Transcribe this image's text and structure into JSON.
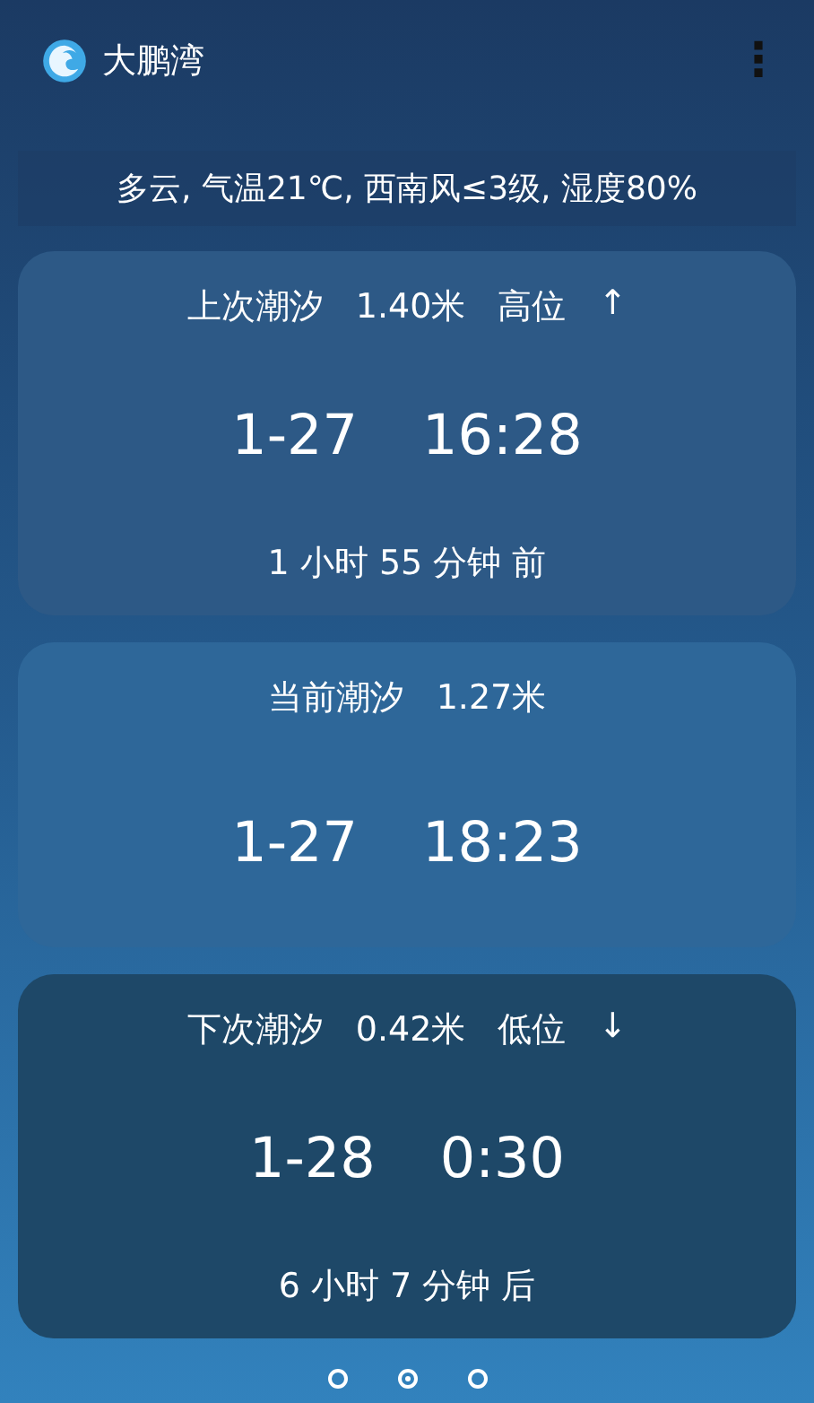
{
  "app_bar": {
    "title": "大鹏湾",
    "menu": "⋮"
  },
  "weather": "多云, 气温21℃, 西南风≤3级, 湿度80%",
  "tides": [
    {
      "label": "上次潮汐",
      "height": "1.40米",
      "type": "高位",
      "arrow": "↑",
      "date": "1-27",
      "time": "16:28",
      "relative": "1 小时 55 分钟 前",
      "color": "#2d5986"
    },
    {
      "label": "当前潮汐",
      "height": "1.27米",
      "date": "1-27",
      "time": "18:23",
      "color": "#2e6799"
    },
    {
      "label": "下次潮汐",
      "height": "0.42米",
      "type": "低位",
      "arrow": "↓",
      "date": "1-28",
      "time": "0:30",
      "relative": "6 小时 7 分钟 后",
      "color": "#1e4868"
    }
  ],
  "pager": [
    {
      "selected": false
    },
    {
      "selected": true
    },
    {
      "selected": false
    }
  ]
}
